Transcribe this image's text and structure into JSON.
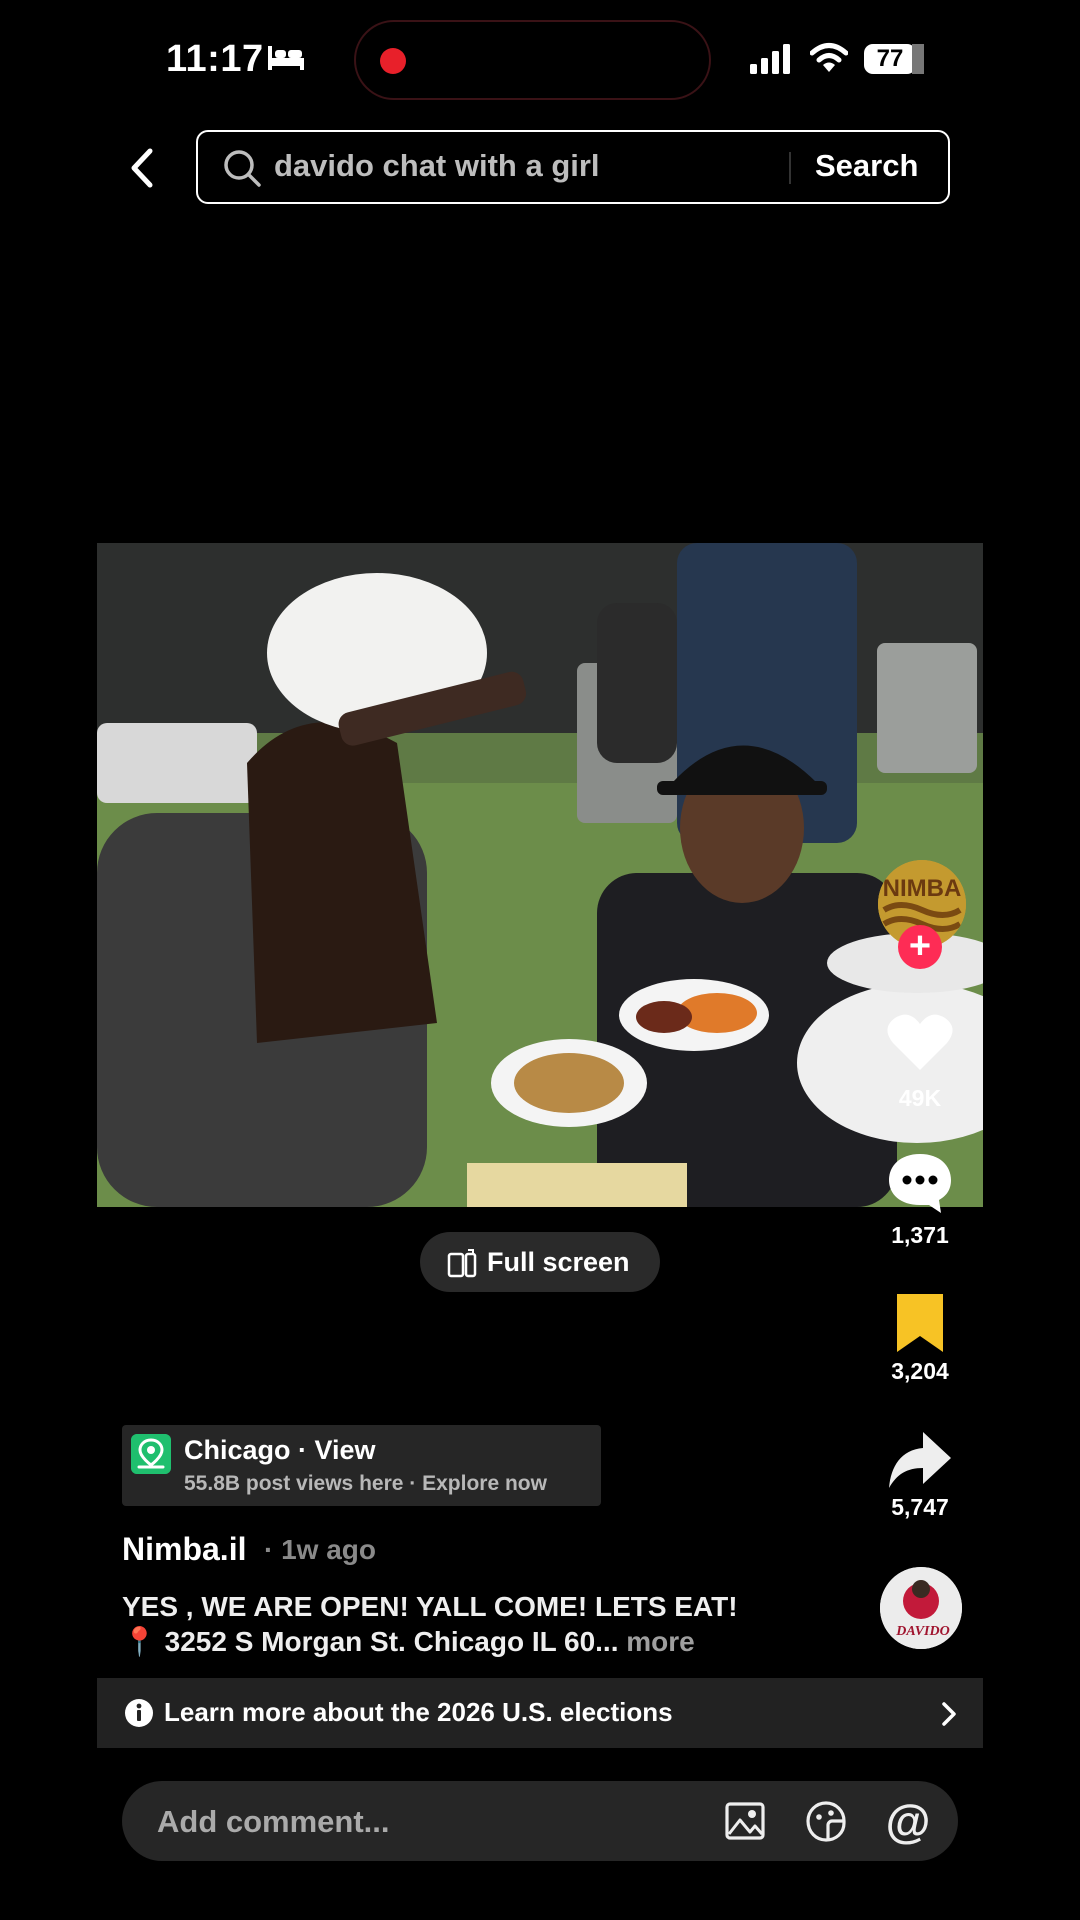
{
  "status_bar": {
    "time": "11:17",
    "battery": "77",
    "icons": [
      "bed-icon",
      "signal-icon",
      "wifi-icon",
      "battery-icon"
    ]
  },
  "search": {
    "query": "davido chat with a girl",
    "button_label": "Search"
  },
  "video": {
    "overlay_logo_text": "NIMBA",
    "full_screen_label": "Full screen"
  },
  "actions": {
    "likes": "49K",
    "comments": "1,371",
    "saves": "3,204",
    "shares": "5,747"
  },
  "location": {
    "title": "Chicago · View",
    "subtitle": "55.8B post views here · Explore now"
  },
  "post": {
    "author": "Nimba.il",
    "time_ago": "· 1w ago",
    "caption_line1": "YES , WE ARE OPEN! YALL COME! LETS EAT!",
    "caption_line2": "📍 3252 S Morgan St. Chicago IL 60...",
    "more_label": "more",
    "disc_text": "DAVIDO"
  },
  "banner": {
    "text": "Learn more about the 2026 U.S. elections"
  },
  "comment": {
    "placeholder": "Add comment..."
  },
  "colors": {
    "accent_red": "#fe2c55",
    "bookmark_yellow": "#f7c325",
    "location_green": "#1fbf6e"
  }
}
